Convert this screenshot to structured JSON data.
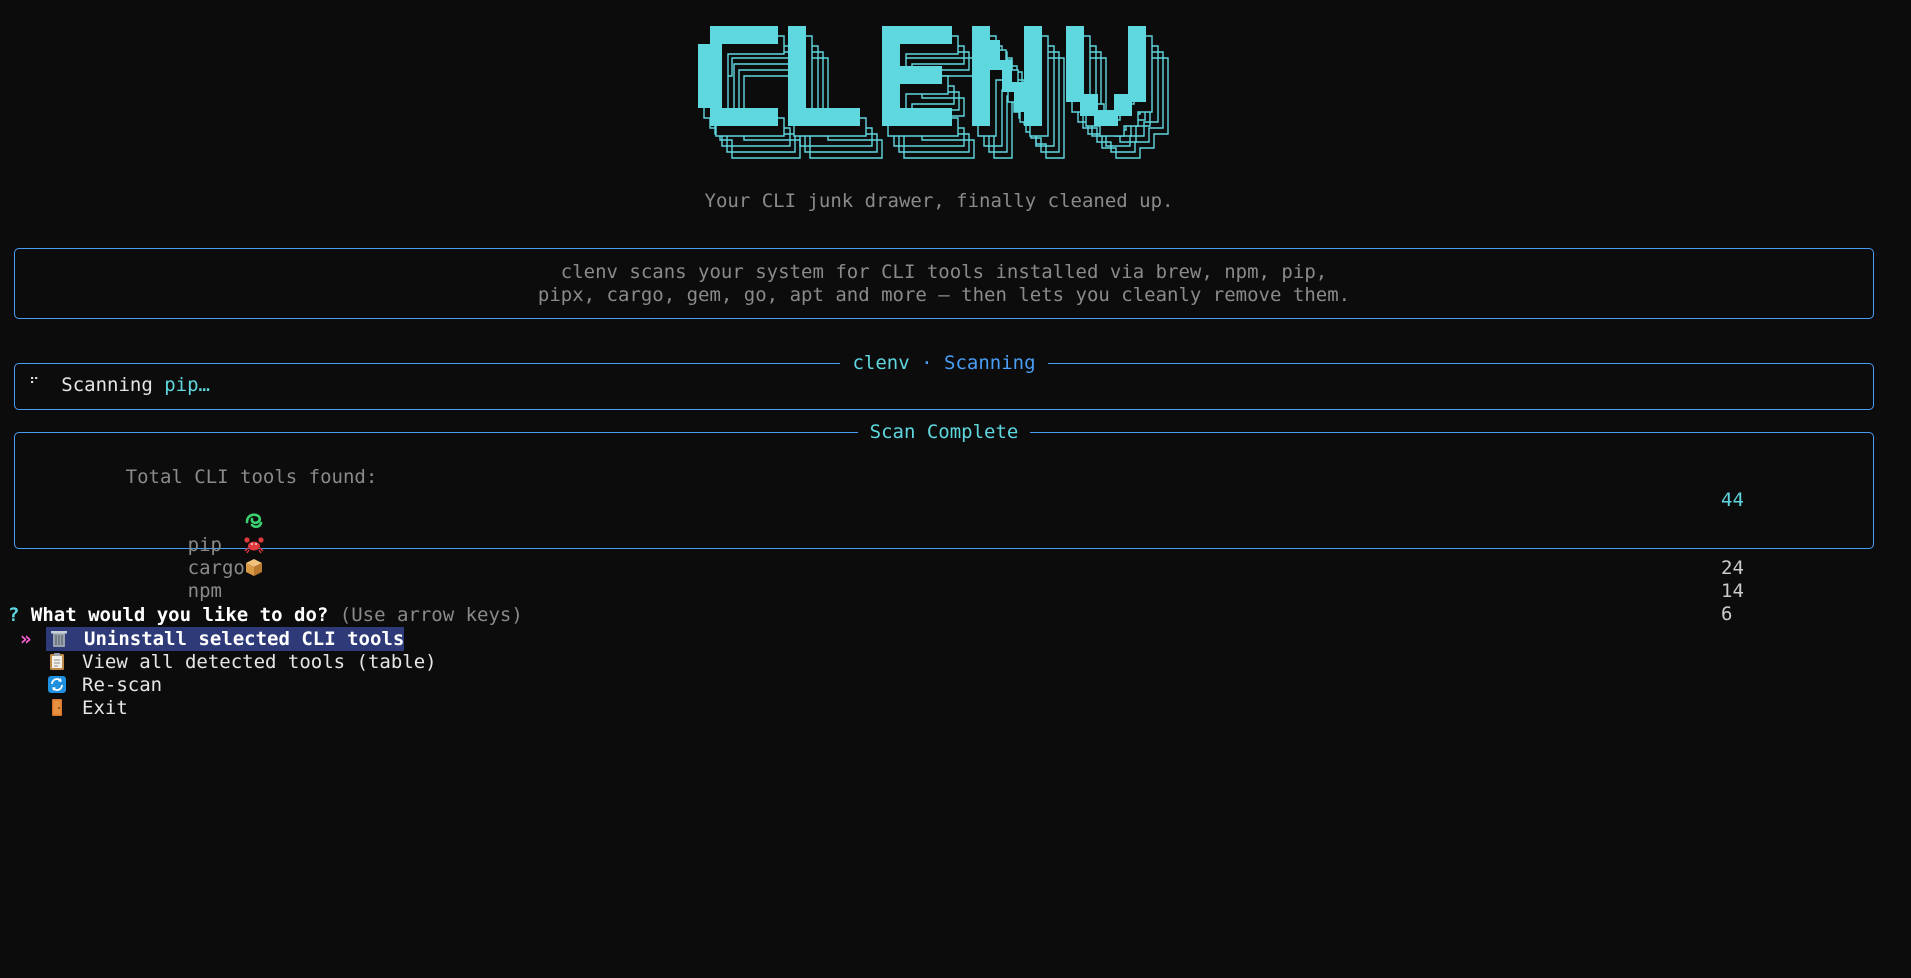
{
  "app": {
    "logo_text": "CLENV",
    "tagline": "Your CLI junk drawer, finally cleaned up."
  },
  "info": {
    "line1": "clenv scans your system for CLI tools installed via brew, npm, pip,",
    "line2": "pipx, cargo, gem, go, apt and more — then lets you cleanly remove them."
  },
  "scan": {
    "title_app": "clenv",
    "title_sep": "·",
    "title_status": "Scanning",
    "spinner": "⠋",
    "status_prefix": "Scanning ",
    "status_target": "pip…"
  },
  "summary": {
    "title": "Scan Complete",
    "total_label": "Total CLI tools found:",
    "total_count": "44",
    "managers": [
      {
        "icon": "python-snake-icon",
        "name": "pip",
        "count": "24"
      },
      {
        "icon": "crab-icon",
        "name": "cargo",
        "count": "14"
      },
      {
        "icon": "package-box-icon",
        "name": "npm",
        "count": "6"
      }
    ]
  },
  "prompt": {
    "mark": "?",
    "question": "What would you like to do?",
    "hint": "(Use arrow keys)",
    "pointer": "»",
    "options": [
      {
        "icon": "trash-can-icon",
        "label": "Uninstall selected CLI tools",
        "selected": true
      },
      {
        "icon": "clipboard-icon",
        "label": "View all detected tools (table)",
        "selected": false
      },
      {
        "icon": "refresh-icon",
        "label": "Re-scan",
        "selected": false
      },
      {
        "icon": "door-icon",
        "label": "Exit",
        "selected": false
      }
    ]
  },
  "colors": {
    "background": "#0c0c0c",
    "accent_cyan": "#5fd7df",
    "border_blue": "#4a9df5",
    "pointer_pink": "#ff5fd7",
    "selection_bg": "#2f3a78",
    "muted_text": "#8a8a8a"
  }
}
